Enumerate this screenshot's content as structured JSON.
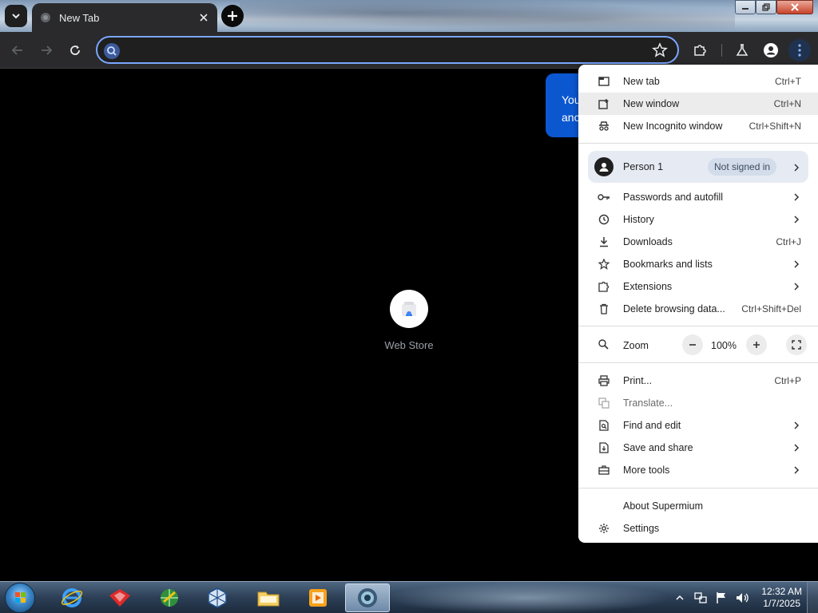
{
  "tab": {
    "title": "New Tab"
  },
  "omnibox": {
    "value": "",
    "placeholder": ""
  },
  "content": {
    "shortcut_label": "Web Store",
    "promo_line1": "You",
    "promo_line2": "anc"
  },
  "menu": {
    "new_tab": {
      "label": "New tab",
      "shortcut": "Ctrl+T"
    },
    "new_window": {
      "label": "New window",
      "shortcut": "Ctrl+N"
    },
    "incognito": {
      "label": "New Incognito window",
      "shortcut": "Ctrl+Shift+N"
    },
    "profile": {
      "name": "Person 1",
      "status": "Not signed in"
    },
    "passwords": {
      "label": "Passwords and autofill"
    },
    "history": {
      "label": "History"
    },
    "downloads": {
      "label": "Downloads",
      "shortcut": "Ctrl+J"
    },
    "bookmarks": {
      "label": "Bookmarks and lists"
    },
    "extensions": {
      "label": "Extensions"
    },
    "delete_data": {
      "label": "Delete browsing data...",
      "shortcut": "Ctrl+Shift+Del"
    },
    "zoom": {
      "label": "Zoom",
      "value": "100%"
    },
    "print": {
      "label": "Print...",
      "shortcut": "Ctrl+P"
    },
    "translate": {
      "label": "Translate..."
    },
    "find_edit": {
      "label": "Find and edit"
    },
    "save_share": {
      "label": "Save and share"
    },
    "more_tools": {
      "label": "More tools"
    },
    "about": {
      "label": "About Supermium"
    },
    "settings": {
      "label": "Settings"
    }
  },
  "taskbar": {
    "apps": [
      "start-menu",
      "internet-explorer",
      "tools-app",
      "network-globe",
      "virtualbox",
      "file-explorer",
      "media-player",
      "supermium-browser"
    ],
    "clock_time": "12:32 AM",
    "clock_date": "1/7/2025"
  },
  "colors": {
    "accent": "#7aa7ff",
    "promo": "#0b57d0",
    "toolbar": "#2a2a2d",
    "menu_bg": "#ffffff"
  }
}
